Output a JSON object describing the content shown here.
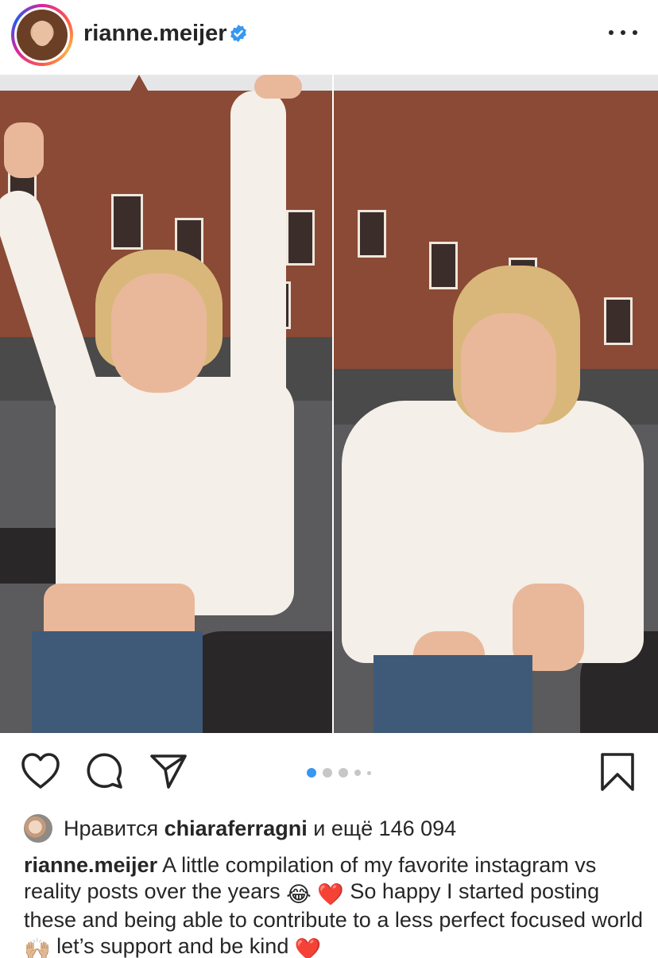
{
  "post": {
    "username": "rianne.meijer",
    "verified": true,
    "carousel": {
      "total": 5,
      "active": 1
    },
    "likes": {
      "prefix": "Нравится",
      "user": "chiaraferragni",
      "suffix": "и ещё 146 094"
    },
    "caption": {
      "username": "rianne.meijer",
      "part1": "A little compilation of my favorite instagram vs reality posts over the years",
      "part2": "So happy I started posting these and being able to contribute to a less perfect focused world",
      "part3": "let’s support and be kind"
    }
  },
  "icons": [
    "more-icon",
    "verified-icon",
    "heart-icon",
    "comment-icon",
    "share-icon",
    "bookmark-icon"
  ],
  "colors": {
    "verified": "#3897f0",
    "dot_active": "#3897f0",
    "dot_inactive": "#c7c7c7",
    "text": "#262626"
  }
}
